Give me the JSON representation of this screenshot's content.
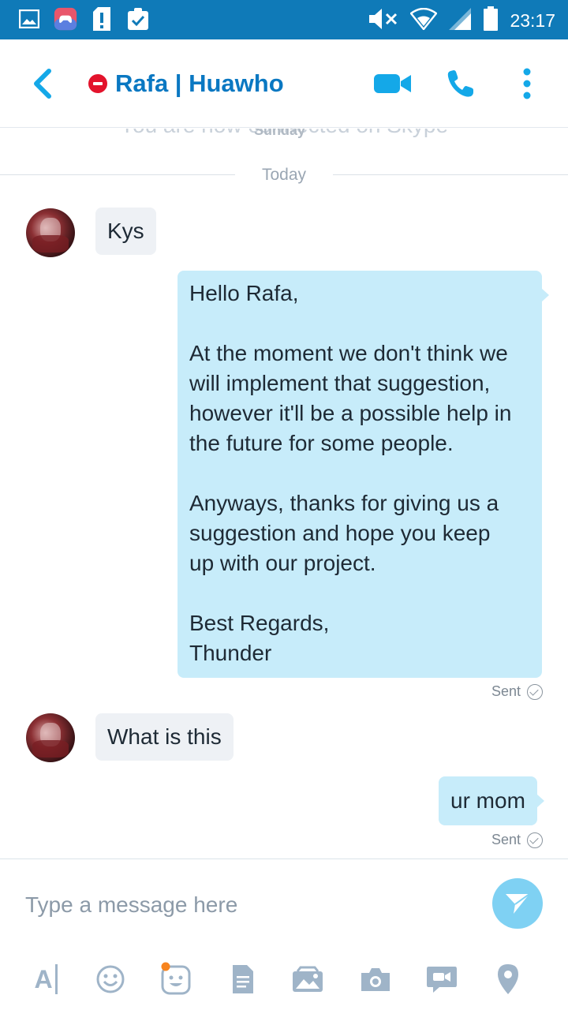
{
  "status_bar": {
    "time": "23:17",
    "icons": [
      "gallery-icon",
      "game-icon",
      "sd-card-alert-icon",
      "clipboard-check-icon",
      "mute-icon",
      "wifi-icon",
      "signal-icon",
      "battery-icon"
    ]
  },
  "header": {
    "contact_name": "Rafa | Huawho",
    "presence": "do-not-disturb",
    "actions": [
      "video-call-icon",
      "audio-call-icon",
      "more-options-icon"
    ]
  },
  "chat": {
    "faded_banner": "You are now connected on Skype",
    "faded_overlay": "Sunday",
    "date_divider": "Today",
    "messages": [
      {
        "direction": "incoming",
        "text": "Kys"
      },
      {
        "direction": "outgoing",
        "lines": [
          "Hello Rafa,",
          "",
          "At the moment we don't think we",
          "will implement that suggestion,",
          "however it'll be a possible help in",
          "the future for some people.",
          "",
          "Anyways, thanks for giving us a",
          "suggestion and hope you keep",
          "up with our project.",
          "",
          "Best Regards,",
          "Thunder"
        ],
        "status": "Sent"
      },
      {
        "direction": "incoming",
        "text": "What is this"
      },
      {
        "direction": "outgoing",
        "text": "ur mom",
        "status": "Sent"
      }
    ]
  },
  "composer": {
    "placeholder": "Type a message here",
    "tools": [
      "text-format-icon",
      "emoji-icon",
      "sticker-icon",
      "file-icon",
      "media-icon",
      "camera-icon",
      "video-message-icon",
      "location-icon"
    ]
  },
  "colors": {
    "status_bar": "#0f7ab8",
    "brand_blue": "#0a78c2",
    "accent_blue": "#14a8e8",
    "outgoing_bubble": "#c7ecfa",
    "incoming_bubble": "#eef1f5",
    "presence_dnd": "#e3132c"
  }
}
